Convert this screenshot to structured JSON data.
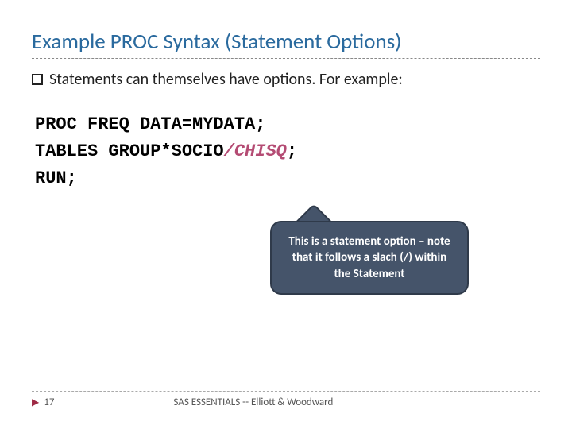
{
  "title": "Example PROC Syntax (Statement Options)",
  "bullet": "Statements can themselves have options. For example:",
  "code": {
    "line1": "PROC FREQ DATA=MYDATA;",
    "line2_pre": "TABLES GROUP*SOCIO",
    "line2_opt": "/CHISQ",
    "line2_post": ";",
    "line3": "RUN;"
  },
  "callout": "This is a statement option – note that it follows a slach (/) within the Statement",
  "footer": {
    "page": "17",
    "text": "SAS ESSENTIALS -- Elliott & Woodward"
  }
}
